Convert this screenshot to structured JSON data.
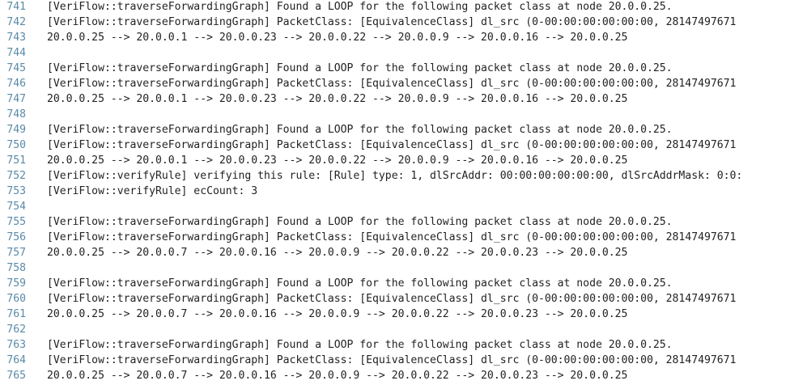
{
  "colors": {
    "background": "#ffffff",
    "line_number": "#5a8aa8",
    "text": "#222222"
  },
  "editor": {
    "lines": [
      {
        "number": "741",
        "text": "[VeriFlow::traverseForwardingGraph] Found a LOOP for the following packet class at node 20.0.0.25."
      },
      {
        "number": "742",
        "text": "[VeriFlow::traverseForwardingGraph] PacketClass: [EquivalenceClass] dl_src (0-00:00:00:00:00:00, 28147497671"
      },
      {
        "number": "743",
        "text": "20.0.0.25 --> 20.0.0.1 --> 20.0.0.23 --> 20.0.0.22 --> 20.0.0.9 --> 20.0.0.16 --> 20.0.0.25"
      },
      {
        "number": "744",
        "text": ""
      },
      {
        "number": "745",
        "text": "[VeriFlow::traverseForwardingGraph] Found a LOOP for the following packet class at node 20.0.0.25."
      },
      {
        "number": "746",
        "text": "[VeriFlow::traverseForwardingGraph] PacketClass: [EquivalenceClass] dl_src (0-00:00:00:00:00:00, 28147497671"
      },
      {
        "number": "747",
        "text": "20.0.0.25 --> 20.0.0.1 --> 20.0.0.23 --> 20.0.0.22 --> 20.0.0.9 --> 20.0.0.16 --> 20.0.0.25"
      },
      {
        "number": "748",
        "text": ""
      },
      {
        "number": "749",
        "text": "[VeriFlow::traverseForwardingGraph] Found a LOOP for the following packet class at node 20.0.0.25."
      },
      {
        "number": "750",
        "text": "[VeriFlow::traverseForwardingGraph] PacketClass: [EquivalenceClass] dl_src (0-00:00:00:00:00:00, 28147497671"
      },
      {
        "number": "751",
        "text": "20.0.0.25 --> 20.0.0.1 --> 20.0.0.23 --> 20.0.0.22 --> 20.0.0.9 --> 20.0.0.16 --> 20.0.0.25"
      },
      {
        "number": "752",
        "text": "[VeriFlow::verifyRule] verifying this rule: [Rule] type: 1, dlSrcAddr: 00:00:00:00:00:00, dlSrcAddrMask: 0:0:"
      },
      {
        "number": "753",
        "text": "[VeriFlow::verifyRule] ecCount: 3"
      },
      {
        "number": "754",
        "text": ""
      },
      {
        "number": "755",
        "text": "[VeriFlow::traverseForwardingGraph] Found a LOOP for the following packet class at node 20.0.0.25."
      },
      {
        "number": "756",
        "text": "[VeriFlow::traverseForwardingGraph] PacketClass: [EquivalenceClass] dl_src (0-00:00:00:00:00:00, 28147497671"
      },
      {
        "number": "757",
        "text": "20.0.0.25 --> 20.0.0.7 --> 20.0.0.16 --> 20.0.0.9 --> 20.0.0.22 --> 20.0.0.23 --> 20.0.0.25"
      },
      {
        "number": "758",
        "text": ""
      },
      {
        "number": "759",
        "text": "[VeriFlow::traverseForwardingGraph] Found a LOOP for the following packet class at node 20.0.0.25."
      },
      {
        "number": "760",
        "text": "[VeriFlow::traverseForwardingGraph] PacketClass: [EquivalenceClass] dl_src (0-00:00:00:00:00:00, 28147497671"
      },
      {
        "number": "761",
        "text": "20.0.0.25 --> 20.0.0.7 --> 20.0.0.16 --> 20.0.0.9 --> 20.0.0.22 --> 20.0.0.23 --> 20.0.0.25"
      },
      {
        "number": "762",
        "text": ""
      },
      {
        "number": "763",
        "text": "[VeriFlow::traverseForwardingGraph] Found a LOOP for the following packet class at node 20.0.0.25."
      },
      {
        "number": "764",
        "text": "[VeriFlow::traverseForwardingGraph] PacketClass: [EquivalenceClass] dl_src (0-00:00:00:00:00:00, 28147497671"
      },
      {
        "number": "765",
        "text": "20.0.0.25 --> 20.0.0.7 --> 20.0.0.16 --> 20.0.0.9 --> 20.0.0.22 --> 20.0.0.23 --> 20.0.0.25"
      }
    ]
  }
}
